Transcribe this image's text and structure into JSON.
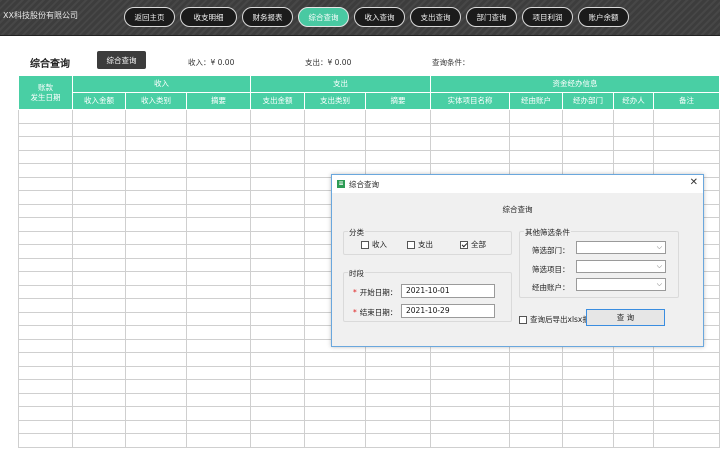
{
  "header": {
    "company": "XX科技股份有限公司",
    "nav": [
      {
        "label": "返回主页",
        "active": false
      },
      {
        "label": "收支明细",
        "active": false
      },
      {
        "label": "财务报表",
        "active": false
      },
      {
        "label": "综合查询",
        "active": true
      },
      {
        "label": "收入查询",
        "active": false
      },
      {
        "label": "支出查询",
        "active": false
      },
      {
        "label": "部门查询",
        "active": false
      },
      {
        "label": "项目利润",
        "active": false
      },
      {
        "label": "账户余额",
        "active": false
      }
    ]
  },
  "query_header": {
    "title": "综合查询",
    "button": "综合查询",
    "income": "收入：¥ 0.00",
    "expense": "支出：¥ 0.00",
    "conditions": "查询条件："
  },
  "table": {
    "date_col_line1": "账款",
    "date_col_line2": "发生日期",
    "groups": [
      "收入",
      "支出",
      "资金经办信息"
    ],
    "columns": [
      "收入金额",
      "收入类别",
      "摘要",
      "支出金额",
      "支出类别",
      "摘要",
      "实体项目名称",
      "经由账户",
      "经办部门",
      "经办人",
      "备注"
    ],
    "row_count": 25
  },
  "dialog": {
    "title": "综合查询",
    "heading": "综合查询",
    "category_group": "分类",
    "cb_income": "收入",
    "cb_expense": "支出",
    "cb_all": "全部",
    "period_group": "时段",
    "start_label": "开始日期：",
    "start_value": "2021-10-01",
    "end_label": "结束日期：",
    "end_value": "2021-10-29",
    "other_group": "其他筛选条件",
    "dept_label": "筛选部门：",
    "project_label": "筛选项目：",
    "account_label": "经由账户：",
    "export_label": "查询后导出xlsx报表",
    "query_button": "查 询",
    "checked": {
      "income": false,
      "expense": false,
      "all": true,
      "export": false
    }
  },
  "colors": {
    "accent": "#49cfa4",
    "topbar": "#3d3d3d",
    "dialog_border": "#6aa7dd"
  }
}
